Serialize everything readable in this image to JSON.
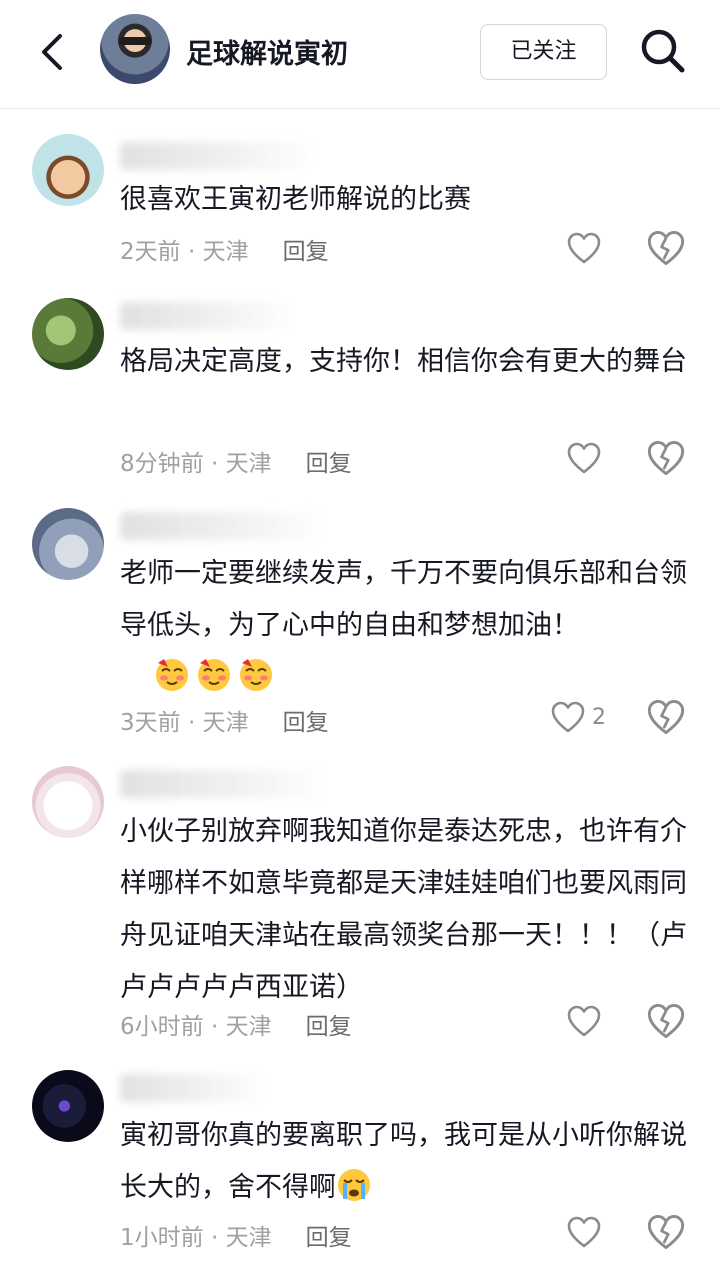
{
  "header": {
    "title": "足球解说寅初",
    "follow_label": "已关注"
  },
  "comments": [
    {
      "text": "很喜欢王寅初老师解说的比赛",
      "time": "2天前 · 天津",
      "reply": "回复",
      "likes": "",
      "avatar_colors": [
        "#bfe3e6",
        "#f2c9a0"
      ]
    },
    {
      "text": "格局决定高度，支持你！相信你会有更大的舞台",
      "time": "8分钟前 · 天津",
      "reply": "回复",
      "likes": "",
      "avatar_colors": [
        "#5a7a3a",
        "#a4c476"
      ]
    },
    {
      "text": "老师一定要继续发声，千万不要向俱乐部和台领导低头，为了心中的自由和梦想加油！",
      "emoji": [
        "blush-emoji",
        "blush-emoji",
        "blush-emoji"
      ],
      "time": "3天前 · 天津",
      "reply": "回复",
      "likes": "2",
      "avatar_colors": [
        "#8fa0b8",
        "#d9dde6"
      ]
    },
    {
      "text": "小伙子别放弃啊我知道你是泰达死忠，也许有介样哪样不如意毕竟都是天津娃娃咱们也要风雨同舟见证咱天津站在最高领奖台那一天！！！（卢卢卢卢卢卢西亚诺）",
      "time": "6小时前 · 天津",
      "reply": "回复",
      "likes": "",
      "avatar_colors": [
        "#f3e6ea",
        "#ffffff"
      ]
    },
    {
      "text": "寅初哥你真的要离职了吗，我可是从小听你解说长大的，舍不得啊",
      "emoji": [
        "crying-emoji"
      ],
      "time": "1小时前 · 天津",
      "reply": "回复",
      "likes": "",
      "avatar_colors": [
        "#0a0a1a",
        "#6a4bd1"
      ]
    }
  ]
}
